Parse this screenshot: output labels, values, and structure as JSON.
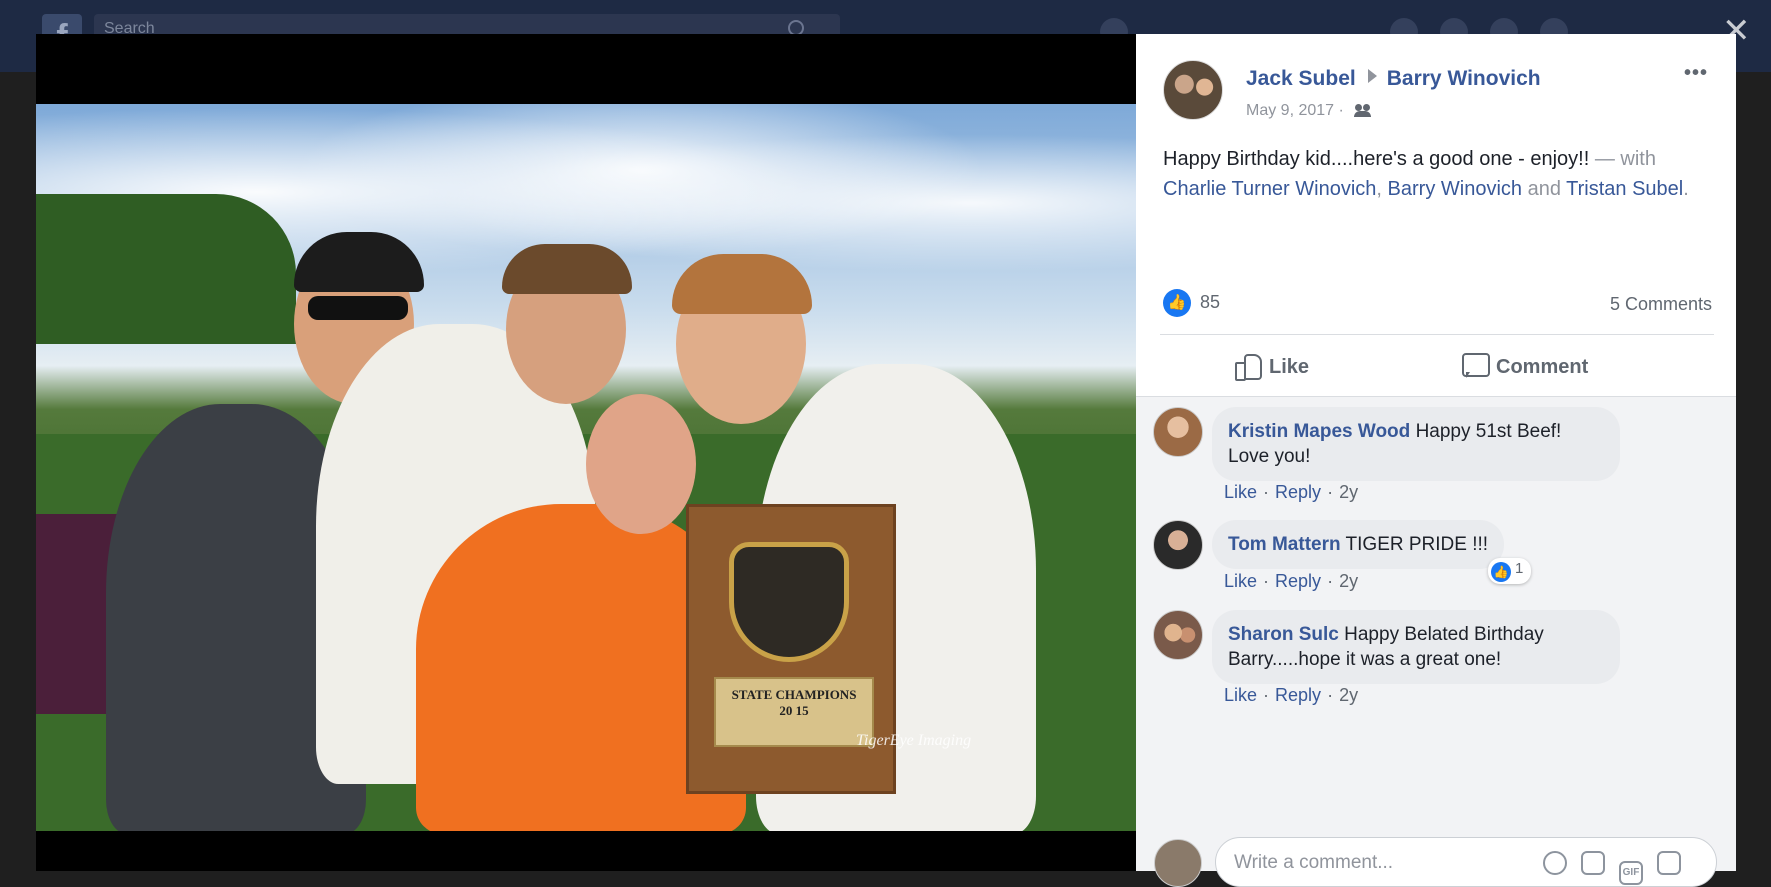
{
  "background": {
    "search_placeholder": "Search"
  },
  "viewer": {
    "close_label": "✕"
  },
  "photo": {
    "plaque_title": "STATE CHAMPIONS",
    "plaque_year": "20 15",
    "watermark": "TigerEye Imaging"
  },
  "post": {
    "author": "Jack Subel",
    "recipient": "Barry Winovich",
    "date": "May 9, 2017 ·",
    "more_label": "•••",
    "text": "Happy Birthday kid....here's a good one - enjoy!!",
    "with_prefix": " — with ",
    "tags": [
      "Charlie Turner Winovich",
      "Barry Winovich",
      "Tristan Subel"
    ],
    "tag_sep_1": ", ",
    "tag_sep_2": " and ",
    "tag_end": "."
  },
  "stats": {
    "likes": "85",
    "comments": "5 Comments"
  },
  "actions": {
    "like": "Like",
    "comment": "Comment"
  },
  "comments": [
    {
      "name": "Kristin Mapes Wood",
      "text": "Happy 51st Beef! Love you!",
      "like": "Like",
      "reply": "Reply",
      "time": "2y"
    },
    {
      "name": "Tom Mattern",
      "text": "TIGER PRIDE !!!",
      "like": "Like",
      "reply": "Reply",
      "time": "2y",
      "reactions": "1"
    },
    {
      "name": "Sharon Sulc",
      "text": "Happy Belated Birthday Barry.....hope it was a great one!",
      "like": "Like",
      "reply": "Reply",
      "time": "2y"
    }
  ],
  "composer": {
    "placeholder": "Write a comment..."
  },
  "colors": {
    "link": "#385898",
    "like_blue": "#1877f2",
    "panel_bg": "#ffffff",
    "comments_bg": "#f2f3f5"
  }
}
